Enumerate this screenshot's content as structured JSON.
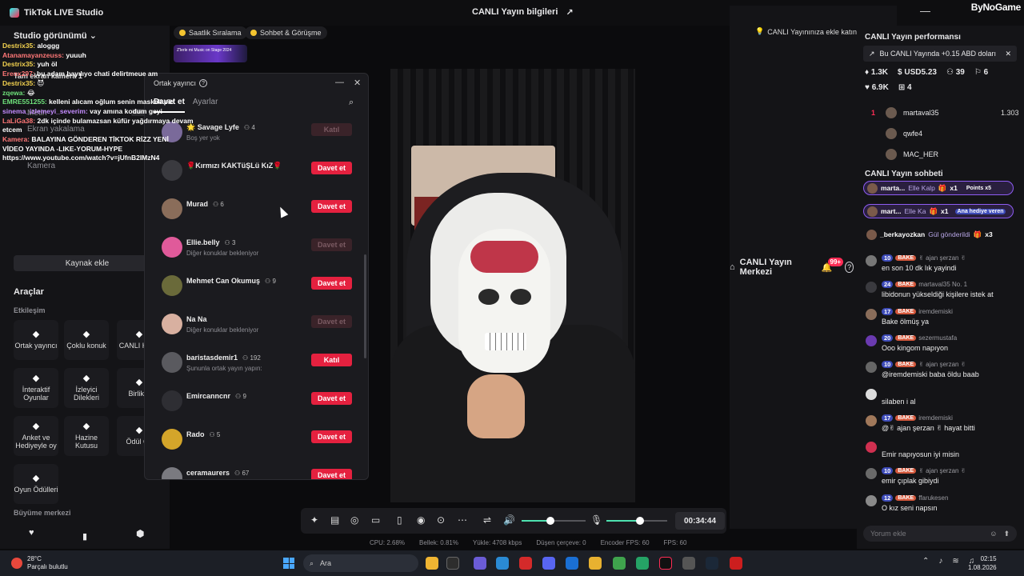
{
  "titlebar": {
    "app_name": "TikTok LIVE Studio",
    "center_title": "CANLI Yayın bilgileri",
    "center_icon": "share-icon",
    "right_label": "CANLI Yayın Merkezi",
    "notif_badge": "99+",
    "watermark": "ByNoGame"
  },
  "left": {
    "header": "Studio görünümü",
    "scenes": [
      "Tam ekran kamera 1",
      "Gös",
      "Ekran yakalama",
      "Kamera"
    ],
    "scene_sub": "Metin",
    "add_source": "Kaynak ekle",
    "tools_title": "Araçlar",
    "section_interaction": "Etkileşim",
    "section_growth": "Büyüme merkezi",
    "tools": [
      {
        "label": "Ortak yayıncı",
        "icon": "link-icon"
      },
      {
        "label": "Çoklu konuk",
        "icon": "users-icon"
      },
      {
        "label": "CANLI Hede",
        "icon": "target-icon"
      },
      {
        "label": "İnteraktif Oyunlar",
        "icon": "gamepad-icon"
      },
      {
        "label": "İzleyici Dilekleri",
        "icon": "gift-icon"
      },
      {
        "label": "Birlikte",
        "icon": "person-icon"
      },
      {
        "label": "Anket ve Hediyeyle oy",
        "icon": "poll-icon"
      },
      {
        "label": "Hazine Kutusu",
        "icon": "chest-icon"
      },
      {
        "label": "Ödül Ça",
        "icon": "trophy-icon"
      },
      {
        "label": "Oyun Ödülleri",
        "icon": "bag-icon"
      }
    ]
  },
  "overlay_chat": [
    {
      "name": "Destrix35:",
      "text": " aloggg"
    },
    {
      "name": "Atanamayanzeuss:",
      "text": " yuuuh"
    },
    {
      "name": "Destrix35:",
      "text": " yuh öl"
    },
    {
      "name": "Erenx297:",
      "text": " bu adam bayılıyo chati delirtmeue am"
    },
    {
      "name": "Destrix35:",
      "text": " 😈"
    },
    {
      "name": "zqewa:",
      "text": " 😂"
    },
    {
      "name": "EMRE551255:",
      "text": " kelleni alıcam oğlum senin maskeli pic"
    },
    {
      "name": "sinema_izlemeyi_severim:",
      "text": " vay amına kodum geyi"
    },
    {
      "name": "LaLiGa38:",
      "text": " 2dk içinde bulamazsan küfür yağdırmaya devam"
    },
    {
      "name": "",
      "text": "etcem"
    },
    {
      "name": "Kamera:",
      "text": " BALAYINA GÖNDEREN TİKTOK RİZZ YENİ"
    },
    {
      "name": "",
      "text": "VİDEO YAYINDA -LIKE-YORUM-HYPE"
    },
    {
      "name": "",
      "text": "https://www.youtube.com/watch?v=jUfnB2IMzN4"
    }
  ],
  "chips": {
    "hourly": "Saatlik Sıralama",
    "chat_call": "Sohbet & Görüşme",
    "banner": "Z'lerle mi Music on Stage 2024",
    "live_tip": "CANLI Yayınınıza ekle katın"
  },
  "modal": {
    "title": "Ortak yayıncı",
    "tab_invite": "Davet et",
    "tab_settings": "Ayarlar",
    "rows": [
      {
        "name": "🌟 Savage Lyfe",
        "count": "4",
        "status": "Boş yer yok",
        "button": "Katıl",
        "kind": "dim",
        "color": "#7a6a9a"
      },
      {
        "name": "🌹Kırmızı KAKTüŞLü KıZ🌹",
        "count": "",
        "status": "",
        "button": "Davet et",
        "kind": "red",
        "color": "#3a3a3f"
      },
      {
        "name": "Murad",
        "count": "6",
        "status": "",
        "button": "Davet et",
        "kind": "red",
        "color": "#8a6d5a"
      },
      {
        "name": "Ellie.belly",
        "count": "3",
        "status": "Diğer konuklar bekleniyor",
        "button": "Davet et",
        "kind": "dim",
        "color": "#e05a9a"
      },
      {
        "name": "Mehmet Can Okumuş",
        "count": "9",
        "status": "",
        "button": "Davet et",
        "kind": "red",
        "color": "#6a6a3a"
      },
      {
        "name": "Na Na",
        "count": "",
        "status": "Diğer konuklar bekleniyor",
        "button": "Davet et",
        "kind": "dim",
        "color": "#d8b0a0"
      },
      {
        "name": "baristasdemir1",
        "count": "192",
        "status": "Şununla ortak yayın yapın:",
        "button": "Katıl",
        "kind": "red",
        "color": "#5a5a5f"
      },
      {
        "name": "Emircanncnr",
        "count": "9",
        "status": "",
        "button": "Davet et",
        "kind": "red",
        "color": "#2e2e33"
      },
      {
        "name": "Rado",
        "count": "5",
        "status": "",
        "button": "Davet et",
        "kind": "red",
        "color": "#d4a52a"
      },
      {
        "name": "ceramaurers",
        "count": "67",
        "status": "",
        "button": "Davet et",
        "kind": "red",
        "color": "#7a7a80"
      }
    ]
  },
  "controls": {
    "timer": "00:34:44",
    "volume": 0.45,
    "mic": 0.55
  },
  "stats": [
    "CPU: 2.68%",
    "Bellek: 0.81%",
    "Yükle: 4708 kbps",
    "Düşen çerçeve: 0",
    "Encoder FPS: 60",
    "FPS: 60"
  ],
  "right": {
    "perf_title": "CANLI Yayın performansı",
    "perf_note": "Bu CANLI Yayında +0.15 ABD doları",
    "metrics_row1": [
      "1.3K",
      "USD5.23",
      "39",
      "6"
    ],
    "metrics_row2": [
      "6.9K",
      "4"
    ],
    "ranking": [
      {
        "rank": "1",
        "name": "martaval35",
        "score": "1.303"
      },
      {
        "rank": "",
        "name": "qwfe4",
        "score": ""
      },
      {
        "rank": "",
        "name": "MAC_HER",
        "score": ""
      }
    ],
    "chat_title": "CANLI Yayın sohbeti",
    "gift_pills": [
      {
        "name": "marta...",
        "text": "Elle Kalp",
        "mult": "x1",
        "extra": "Points x5"
      },
      {
        "name": "mart...",
        "text": "Elle Ka",
        "mult": "x1",
        "extra": "Ana hediye veren"
      },
      {
        "name": "_berkayozkan",
        "text": "Gül gönderildi",
        "mult": "x3",
        "extra": ""
      }
    ],
    "messages": [
      {
        "level": "10",
        "fan": "BAKE",
        "user": "✌ ajan şerzan ✌",
        "text": "en son 10 dk lık yayindi"
      },
      {
        "level": "24",
        "fan": "BAKE",
        "user": "martaval35 No. 1",
        "text": "libidonun yükseldiği kişilere istek at"
      },
      {
        "level": "17",
        "fan": "BAKE",
        "user": "iremdemiski",
        "text": "Bake ölmüş ya"
      },
      {
        "level": "20",
        "fan": "BAKE",
        "user": "sezermustafa",
        "text": "Ooo kingom napıyon"
      },
      {
        "level": "10",
        "fan": "BAKE",
        "user": "✌ ajan şerzan ✌",
        "text": "@iremdemiski baba öldu baab"
      },
      {
        "level": "",
        "fan": "",
        "user": "",
        "text": "silaben i al"
      },
      {
        "level": "17",
        "fan": "BAKE",
        "user": "iremdemiski",
        "text": "@✌ ajan şerzan ✌ hayat bitti"
      },
      {
        "level": "",
        "fan": "",
        "user": "",
        "text": "Emir napıyosun iyi misin"
      },
      {
        "level": "10",
        "fan": "BAKE",
        "user": "✌ ajan şerzan ✌",
        "text": "emir çıplak gibiydi"
      },
      {
        "level": "12",
        "fan": "BAKE",
        "user": "ffarukesen",
        "text": "O kız seni napsın"
      }
    ],
    "comment_placeholder": "Yorum ekle"
  },
  "taskbar": {
    "temp": "28°C",
    "weather": "Parçalı bulutlu",
    "search": "Ara",
    "time": "02:15",
    "date": "1.08.2026"
  }
}
